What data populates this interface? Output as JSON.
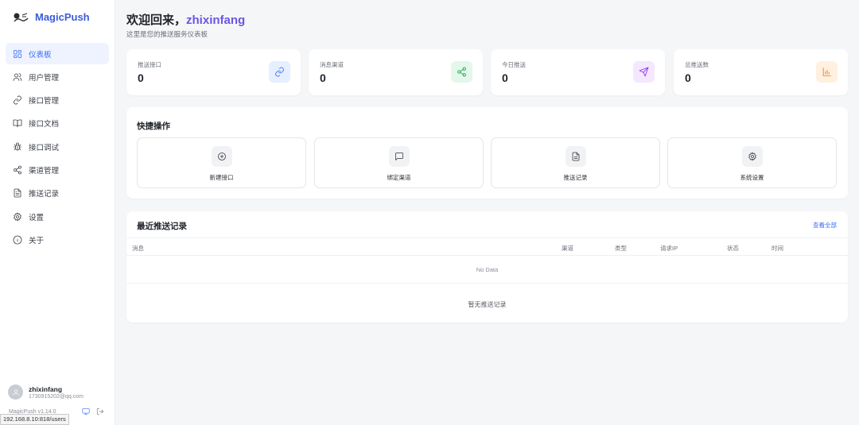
{
  "brand": {
    "name": "MagicPush"
  },
  "nav": [
    {
      "label": "仪表板",
      "icon": "dashboard-icon",
      "active": true
    },
    {
      "label": "用户管理",
      "icon": "users-icon"
    },
    {
      "label": "接口管理",
      "icon": "link-icon"
    },
    {
      "label": "接口文档",
      "icon": "book-icon"
    },
    {
      "label": "接口调试",
      "icon": "bug-icon"
    },
    {
      "label": "渠道管理",
      "icon": "share-icon"
    },
    {
      "label": "推送记录",
      "icon": "file-text-icon"
    },
    {
      "label": "设置",
      "icon": "gear-icon"
    },
    {
      "label": "关于",
      "icon": "info-icon"
    }
  ],
  "user": {
    "name": "zhixinfang",
    "email": "1730915202@qq.com"
  },
  "version": "MagicPush v1.14.0",
  "status_url": "192.168.8.10:818/users",
  "header": {
    "greeting": "欢迎回来，",
    "username": "zhixinfang",
    "subtitle": "这里是您的推送服务仪表板"
  },
  "stats": [
    {
      "label": "推送接口",
      "value": "0",
      "icon": "link-icon",
      "color": "#3b6cf6",
      "bg": "#e6efff"
    },
    {
      "label": "消息渠道",
      "value": "0",
      "icon": "share-icon",
      "color": "#16a34a",
      "bg": "#e3f7ea"
    },
    {
      "label": "今日推送",
      "value": "0",
      "icon": "send-icon",
      "color": "#9333ea",
      "bg": "#f3e8ff"
    },
    {
      "label": "总推送数",
      "value": "0",
      "icon": "bar-chart-icon",
      "color": "#ea7a17",
      "bg": "#fff0e0"
    }
  ],
  "quick_actions": {
    "title": "快捷操作",
    "items": [
      {
        "label": "新建接口",
        "icon": "plus-circle-icon"
      },
      {
        "label": "绑定渠道",
        "icon": "message-icon"
      },
      {
        "label": "推送记录",
        "icon": "file-text-icon"
      },
      {
        "label": "系统设置",
        "icon": "gear-icon"
      }
    ]
  },
  "recent": {
    "title": "最近推送记录",
    "view_all": "查看全部",
    "columns": [
      "消息",
      "渠道",
      "类型",
      "请求IP",
      "状态",
      "时间"
    ],
    "no_data": "No Data",
    "empty_text": "暂无推送记录"
  }
}
